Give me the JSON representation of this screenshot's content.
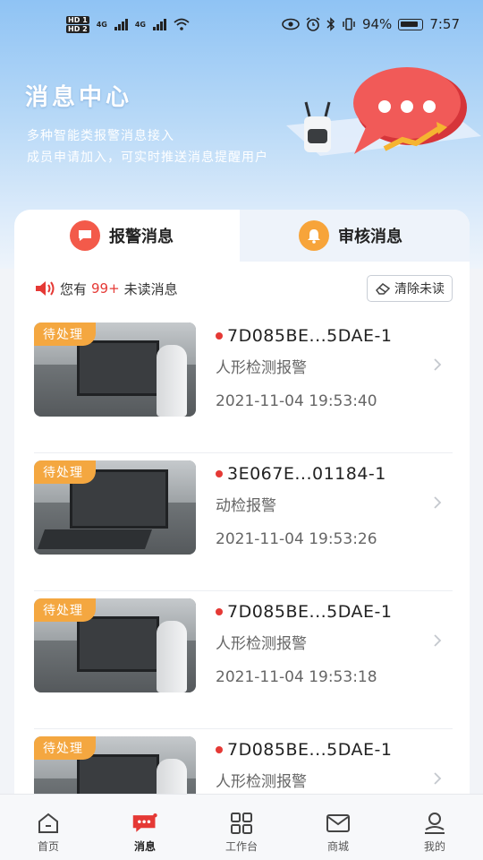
{
  "status_bar": {
    "hd1": "HD 1",
    "hd2": "HD 2",
    "net1": "4G",
    "net2": "4G",
    "battery": "94%",
    "time": "7:57"
  },
  "header": {
    "title": "消息中心",
    "subtitle_line1": "多种智能类报警消息接入",
    "subtitle_line2": "成员申请加入，可实时推送消息提醒用户"
  },
  "tabs": [
    {
      "label": "报警消息",
      "icon": "chat-alert-icon",
      "active": true
    },
    {
      "label": "审核消息",
      "icon": "bell-icon",
      "active": false
    }
  ],
  "unread": {
    "prefix": "您有",
    "count": "99+",
    "suffix": "未读消息",
    "clear_label": "清除未读"
  },
  "messages": [
    {
      "badge": "待处理",
      "device": "7D085BE...5DAE-1",
      "type": "人形检测报警",
      "time": "2021-11-04 19:53:40"
    },
    {
      "badge": "待处理",
      "device": "3E067E...01184-1",
      "type": "动检报警",
      "time": "2021-11-04 19:53:26"
    },
    {
      "badge": "待处理",
      "device": "7D085BE...5DAE-1",
      "type": "人形检测报警",
      "time": "2021-11-04 19:53:18"
    },
    {
      "badge": "待处理",
      "device": "7D085BE...5DAE-1",
      "type": "人形检测报警",
      "time": ""
    }
  ],
  "nav": [
    {
      "label": "首页",
      "icon": "home-icon"
    },
    {
      "label": "消息",
      "icon": "message-icon"
    },
    {
      "label": "工作台",
      "icon": "grid-icon"
    },
    {
      "label": "商城",
      "icon": "mail-icon"
    },
    {
      "label": "我的",
      "icon": "profile-icon"
    }
  ],
  "colors": {
    "accent_red": "#e53935",
    "badge_orange": "#f4a740",
    "hero_blue": "#8fc3f4"
  }
}
